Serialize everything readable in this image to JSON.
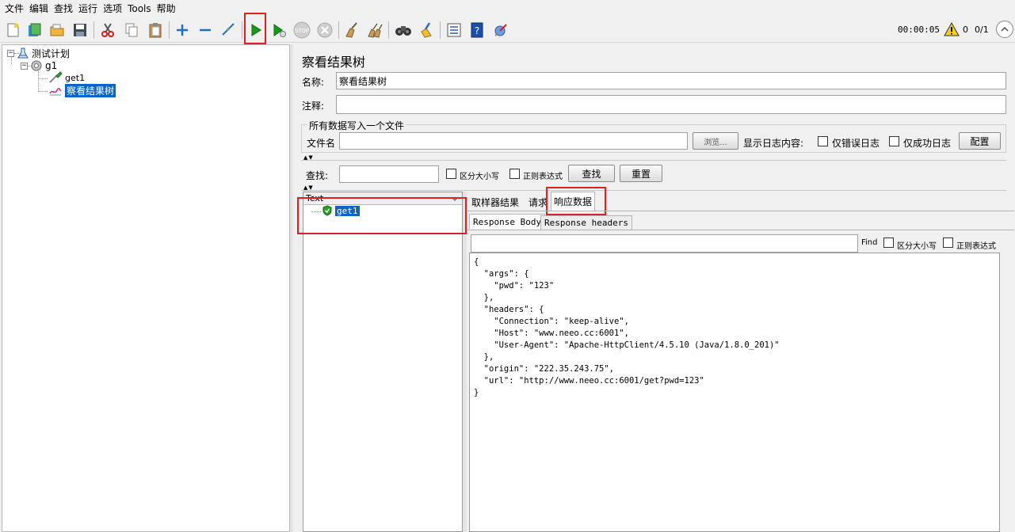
{
  "menu": [
    "文件",
    "编辑",
    "查找",
    "运行",
    "选项",
    "Tools",
    "帮助"
  ],
  "toolbar": {
    "icons": [
      "new-icon",
      "templates-icon",
      "open-icon",
      "save-icon",
      "cut-icon",
      "copy-icon",
      "paste-icon",
      "expand-icon",
      "collapse-icon",
      "toggle-icon",
      "start-icon",
      "start-no-pauses-icon",
      "stop-icon",
      "shutdown-icon",
      "clear-icon",
      "clear-all-icon",
      "search-icon",
      "reset-search-icon",
      "function-helper-icon",
      "help-icon",
      "remote-start-icon"
    ],
    "stop_label": "STOP",
    "timer": "00:00:05",
    "warning_count": "0",
    "threads": "0/1"
  },
  "tree": {
    "root": "测试计划",
    "thread_group": "g1",
    "sampler": "get1",
    "listener": "察看结果树"
  },
  "panel": {
    "title": "察看结果树",
    "name_label": "名称:",
    "name_value": "察看结果树",
    "comment_label": "注释:",
    "comment_value": "",
    "file_group_title": "所有数据写入一个文件",
    "filename_label": "文件名",
    "filename_value": "",
    "browse_label": "浏览...",
    "log_label": "显示日志内容:",
    "errors_only": "仅错误日志",
    "success_only": "仅成功日志",
    "configure": "配置",
    "search_label": "查找:",
    "search_value": "",
    "case_sensitive": "区分大小写",
    "regex": "正则表达式",
    "search_button": "查找",
    "reset_button": "重置"
  },
  "results": {
    "renderer": "Text",
    "items": [
      "get1"
    ]
  },
  "tabs": {
    "sampler_result": "取样器结果",
    "request": "请求",
    "response_data": "响应数据"
  },
  "subtabs": {
    "body": "Response Body",
    "headers": "Response headers"
  },
  "find": {
    "value": "",
    "label": "Find",
    "case": "区分大小写",
    "regex": "正则表达式"
  },
  "response_body": "{\n  \"args\": {\n    \"pwd\": \"123\"\n  },\n  \"headers\": {\n    \"Connection\": \"keep-alive\",\n    \"Host\": \"www.neeo.cc:6001\",\n    \"User-Agent\": \"Apache-HttpClient/4.5.10 (Java/1.8.0_201)\"\n  },\n  \"origin\": \"222.35.243.75\",\n  \"url\": \"http://www.neeo.cc:6001/get?pwd=123\"\n}"
}
